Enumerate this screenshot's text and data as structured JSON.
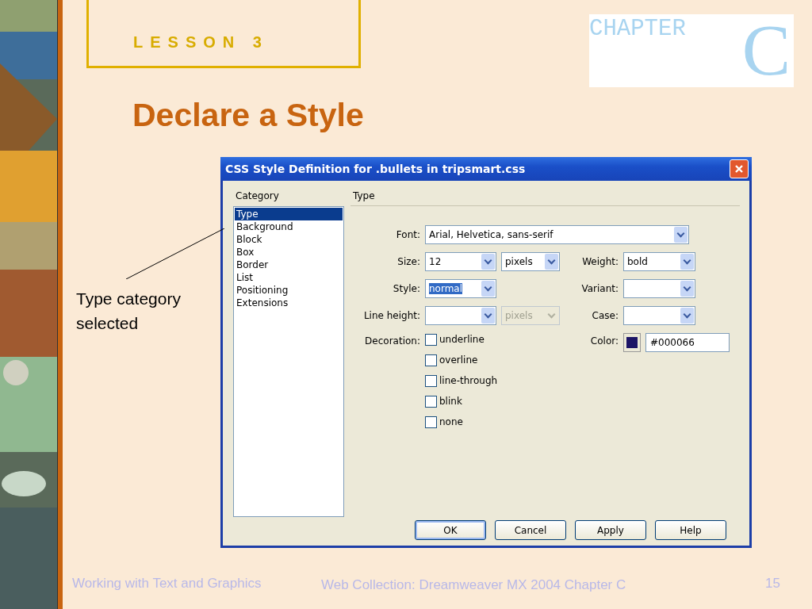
{
  "slide": {
    "lesson": "LESSON 3",
    "title": "Declare a Style",
    "chapter_logo": {
      "word": "CHAPTER",
      "letter": "C"
    },
    "callout": "Type category selected"
  },
  "dialog": {
    "title": "CSS Style Definition for .bullets in tripsmart.css",
    "category_label": "Category",
    "categories": [
      {
        "label": "Type",
        "selected": true
      },
      {
        "label": "Background",
        "selected": false
      },
      {
        "label": "Block",
        "selected": false
      },
      {
        "label": "Box",
        "selected": false
      },
      {
        "label": "Border",
        "selected": false
      },
      {
        "label": "List",
        "selected": false
      },
      {
        "label": "Positioning",
        "selected": false
      },
      {
        "label": "Extensions",
        "selected": false
      }
    ],
    "panel_title": "Type",
    "font": {
      "label": "Font:",
      "value": "Arial, Helvetica, sans-serif"
    },
    "size": {
      "label": "Size:",
      "value": "12",
      "unit": "pixels",
      "unit_disabled": false
    },
    "weight": {
      "label": "Weight:",
      "value": "bold"
    },
    "style": {
      "label": "Style:",
      "value": "normal",
      "text_selected": true
    },
    "variant": {
      "label": "Variant:"
    },
    "line_height": {
      "label": "Line height:",
      "unit": "pixels",
      "unit_disabled": true
    },
    "case": {
      "label": "Case:"
    },
    "decoration": {
      "label": "Decoration:",
      "options": [
        {
          "label": "underline",
          "checked": false
        },
        {
          "label": "overline",
          "checked": false
        },
        {
          "label": "line-through",
          "checked": false
        },
        {
          "label": "blink",
          "checked": false
        },
        {
          "label": "none",
          "checked": false
        }
      ]
    },
    "color": {
      "label": "Color:",
      "color": "#1c1466",
      "value": "#000066"
    },
    "buttons": [
      {
        "label": "OK",
        "default": true
      },
      {
        "label": "Cancel",
        "default": false
      },
      {
        "label": "Apply",
        "default": false
      },
      {
        "label": "Help",
        "default": false
      }
    ]
  },
  "footer": {
    "left": "Working with Text and Graphics",
    "center": "Web Collection: Dreamweaver MX 2004 Chapter C",
    "page": "15"
  }
}
